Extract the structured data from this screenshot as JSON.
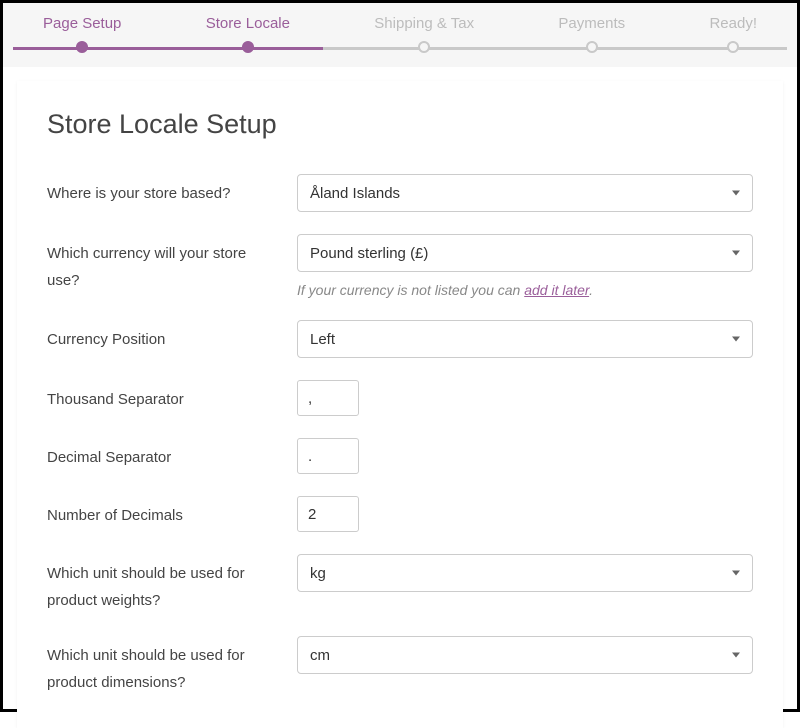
{
  "stepper": {
    "steps": [
      {
        "label": "Page Setup",
        "state": "done"
      },
      {
        "label": "Store Locale",
        "state": "active"
      },
      {
        "label": "Shipping & Tax",
        "state": "pending"
      },
      {
        "label": "Payments",
        "state": "pending"
      },
      {
        "label": "Ready!",
        "state": "pending"
      }
    ]
  },
  "title": "Store Locale Setup",
  "fields": {
    "country": {
      "label": "Where is your store based?",
      "value": "Åland Islands"
    },
    "currency": {
      "label": "Which currency will your store use?",
      "value": "Pound sterling (£)",
      "hint_prefix": "If your currency is not listed you can ",
      "hint_link": "add it later",
      "hint_suffix": "."
    },
    "position": {
      "label": "Currency Position",
      "value": "Left"
    },
    "thousand": {
      "label": "Thousand Separator",
      "value": ","
    },
    "decimal": {
      "label": "Decimal Separator",
      "value": "."
    },
    "decimals": {
      "label": "Number of Decimals",
      "value": "2"
    },
    "weight": {
      "label": "Which unit should be used for product weights?",
      "value": "kg"
    },
    "dimension": {
      "label": "Which unit should be used for product dimensions?",
      "value": "cm"
    }
  }
}
